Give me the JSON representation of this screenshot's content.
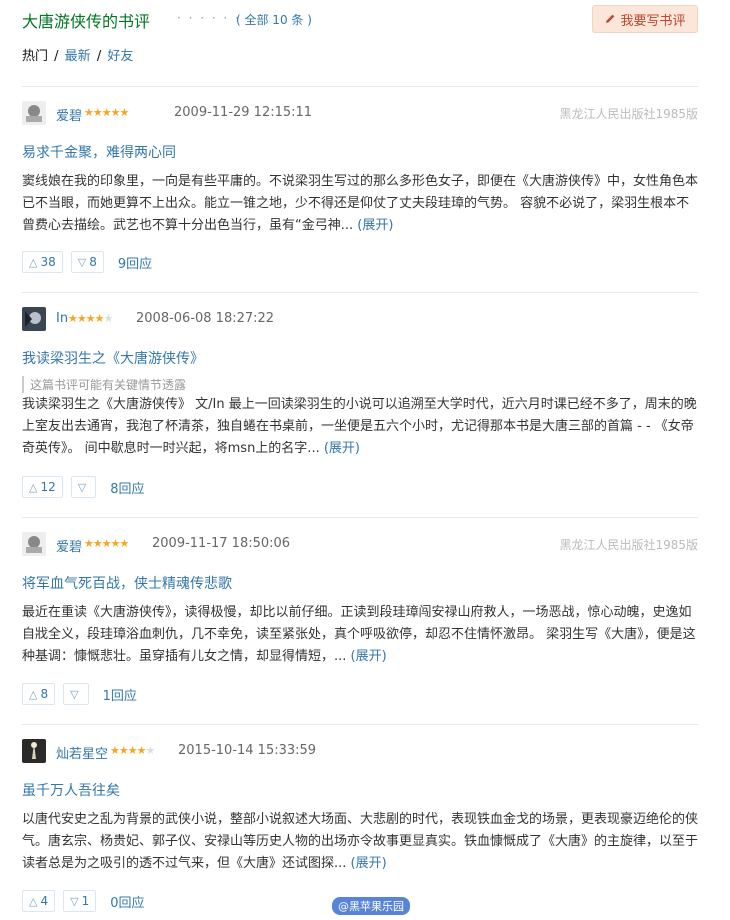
{
  "header": {
    "title": "大唐游侠传的书评",
    "dots": "· · · · · ·",
    "count": "( 全部 10 条 )",
    "write_button": "我要写书评"
  },
  "filters": {
    "hot": "热门",
    "latest": "最新",
    "friends": "好友"
  },
  "reviews": [
    {
      "author": "爱碧",
      "stars": 5,
      "date": "2009-11-29 12:15:11",
      "publisher": "黑龙江人民出版社1985版",
      "title": "易求千金聚，难得两心同",
      "spoiler": "",
      "body": "窦线娘在我的印象里，一向是有些平庸的。不说梁羽生写过的那么多形色女子，即便在《大唐游侠传》中，女性角色本已不当眼，而她更算不上出众。能立一锥之地，少不得还是仰仗了丈夫段珪璋的气势。 容貌不必说了，梁羽生根本不曾费心去描绘。武艺也不算十分出色当行，虽有“金弓神... ",
      "expand": "(展开)",
      "up": "38",
      "down": "8",
      "replies": "9回应"
    },
    {
      "author": "In",
      "stars": 4,
      "date": "2008-06-08 18:27:22",
      "publisher": "",
      "title": "我读梁羽生之《大唐游侠传》",
      "spoiler": "这篇书评可能有关键情节透露",
      "body": "我读梁羽生之《大唐游侠传》 文/In 最上一回读梁羽生的小说可以追溯至大学时代，近六月时课已经不多了，周末的晚上室友出去通宵，我泡了杯清茶，独自蜷在书桌前，一坐便是五六个小时，尤记得那本书是大唐三部的首篇 - - 《女帝奇英传》。 间中歇息时一时兴起，将msn上的名字... ",
      "expand": "(展开)",
      "up": "12",
      "down": "",
      "replies": "8回应"
    },
    {
      "author": "爱碧",
      "stars": 5,
      "date": "2009-11-17 18:50:06",
      "publisher": "黑龙江人民出版社1985版",
      "title": "将军血气死百战，侠士精魂传悲歌",
      "spoiler": "",
      "body": "最近在重读《大唐游侠传》，读得极慢，却比以前仔细。正读到段珪璋闯安禄山府救人，一场恶战，惊心动魄，史逸如自戕全义，段珪璋浴血刺仇，几不幸免，读至紧张处，真个呼吸欲停，却忍不住情怀激昂。 梁羽生写《大唐》，便是这种基调：慷慨悲壮。虽穿插有儿女之情，却显得情短，... ",
      "expand": "(展开)",
      "up": "8",
      "down": "",
      "replies": "1回应"
    },
    {
      "author": "灿若星空",
      "stars": 4,
      "date": "2015-10-14 15:33:59",
      "publisher": "",
      "title": "虽千万人吾往矣",
      "spoiler": "",
      "body": "以唐代安史之乱为背景的武侠小说，整部小说叙述大场面、大悲剧的时代，表现铁血金戈的场景，更表现豪迈绝伦的侠气。唐玄宗、杨贵妃、郭子仪、安禄山等历史人物的出场亦令故事更显真实。铁血慷慨成了《大唐》的主旋律，以至于读者总是为之吸引的透不过气来，但《大唐》还试图探... ",
      "expand": "(展开)",
      "up": "4",
      "down": "1",
      "replies": "0回应"
    }
  ],
  "watermark": "@黑苹果乐园",
  "colors": {
    "title_green": "#007722",
    "link_blue": "#3377aa",
    "star": "#f5a623",
    "button_bg": "#fbe6d9"
  }
}
